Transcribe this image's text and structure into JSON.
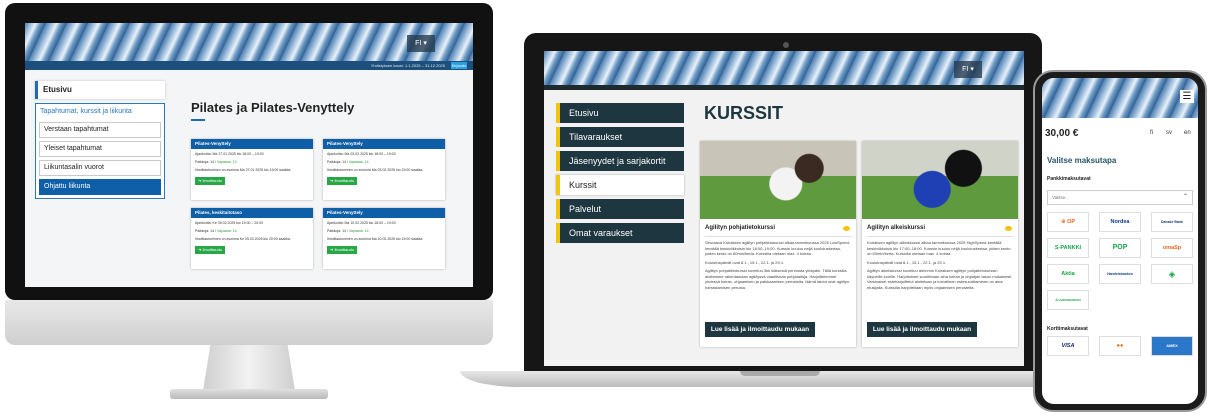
{
  "imac": {
    "apple_logo": "",
    "lang": "FI ▾",
    "infobar_text": "Yhdistyksen kausi: 1.1.2025 – 31.12.2025",
    "info_button": "Kirjaudu",
    "sidebar": {
      "home": "Etusivu",
      "section_title": "Tapahtumat, kurssit ja liikunta",
      "items": [
        "Verstaan tapahtumat",
        "Yleiset tapahtumat",
        "Liikuntasalin vuorot",
        "Ohjattu liikunta"
      ]
    },
    "page_title": "Pilates ja Pilates-Venyttely",
    "cards": [
      {
        "title": "Pilates-Venyttely",
        "time": "Ajankohta: Ma 27.01.2025 klo 18:00 – 19:00",
        "seats_label": "Paikkoja: 14 / ",
        "seats_free": "Vapaana: 13",
        "deadline": "Ilmoittautuminen on avoinna Ma 27.01.2025 klo 19:00 saakka.",
        "button": "➔ Ilmoittaudu"
      },
      {
        "title": "Pilates-Venyttely",
        "time": "Ajankohta: Ma 03.02.2025 klo 18:00 – 19:00",
        "seats_label": "Paikkoja: 14 / ",
        "seats_free": "Vapaana: 14",
        "deadline": "Ilmoittautuminen on avoinna Ma 03.02.2025 klo 19:00 saakka.",
        "button": "➔ Ilmoittaudu"
      },
      {
        "title": "Pilates, keskitaitotaso",
        "time": "Ajankohta: Ke 05.02.2025 klo 19:00 – 20:00",
        "seats_label": "Paikkoja: 14 / ",
        "seats_free": "Vapaana: 14",
        "deadline": "Ilmoittautuminen on avoinna Ke 05.02.2025 klo 20:00 saakka.",
        "button": "➔ Ilmoittaudu"
      },
      {
        "title": "Pilates-Venyttely",
        "time": "Ajankohta: Ma 10.02.2025 klo 18:00 – 19:00",
        "seats_label": "Paikkoja: 14 / ",
        "seats_free": "Vapaana: 14",
        "deadline": "Ilmoittautuminen on avoinna Ma 10.02.2025 klo 19:00 saakka.",
        "button": "➔ Ilmoittaudu"
      }
    ]
  },
  "laptop": {
    "lang": "FI ▾",
    "nav": [
      "Etusivu",
      "Tilavaraukset",
      "Jäsenyydet ja sarjakortit",
      "Kurssit",
      "Palvelut",
      "Omat varaukset"
    ],
    "heading": "KURSSIT",
    "cards": [
      {
        "title": "Agilityn pohjatietokurssi",
        "p1": "Seuraava Koiraksen agilityn pohjatietokurssi alkaa tammikuussa 2025 LowSpeed-kentällä keskiviikkoisin klo 18:00–19:00. Kurssin kuuluu neljä koulutuskertaa, joiden kesto on 60min/kerta. Kurssilla otetaan max. 4 koiraa.",
        "p2": "Koulutuspäivät ovat 8.1., 15.1., 22.1. ja 29.1.",
        "p3": "Agilityn pohjatietokurssi soveltuu 3kk ikäisestä pennusta ylöspäin. Tällä kurssilla aloitamme rakentamaan agilityssä vaadittavia pohjataitoja. Harjoittelemme yhdessä koiran, ohjaamisen ja palkkaamisen perusteita. Nämä taidot ovat agilityn harrastamisen perusta.",
        "button": "Lue lisää ja ilmoittaudu mukaan"
      },
      {
        "title": "Agilityn alkeiskurssi",
        "p1": "Koiraksen agilityn alkeiskurssi alkaa tammikuussa 2025 HighSpeed-kentällä keskiviikkoisin klo 17:00–18:00. Kurssin kuuluu neljä koulutuskertaa, joiden kesto on 60min/kerta. Kurssilla otetaan max. 4 koiraa.",
        "p2": "Koulutuspäivät ovat 8.1., 15.1., 22.1. ja 29.1.",
        "p3": "Agilityn alkeiskurssi soveltuu aiemmin Koiraksen agilityn pohjatietokurssin käyneille koirille. Harjoitukset suoritetaan aina koiran ja ohjaajan tason mukaisesti. Varsinaiset esteharjoittelut aloitetaan ja turvallinen estesuorittaminen on aina etusijalla. Kurssilla harjoitellaan myös ohjaamisen perusteita.",
        "button": "Lue lisää ja ilmoittaudu mukaan"
      }
    ]
  },
  "phone": {
    "menu_icon": "☰",
    "price": "30,00 €",
    "langs": [
      "fi",
      "sv",
      "en"
    ],
    "title": "Valitse maksutapa",
    "bank_section": "Pankkimaksutavat",
    "select_placeholder": "Valitse...",
    "select_chevron": "⌃",
    "banks": [
      "⊕ OP",
      "Nordea",
      "Danske Bank",
      "S-PANKKI",
      "POP",
      "omaSp",
      "Aktia",
      "Handelsbanken",
      "◈",
      "ÅLANDSBANKEN"
    ],
    "card_section": "Korttimaksutavat",
    "cards": [
      "VISA",
      "●●",
      "AMEX"
    ]
  },
  "colors": {
    "imac_blue": "#0f5ea8",
    "imac_green": "#27a745",
    "laptop_dark": "#1d3640",
    "laptop_accent": "#f1c40f",
    "phone_title": "#2b5566"
  }
}
